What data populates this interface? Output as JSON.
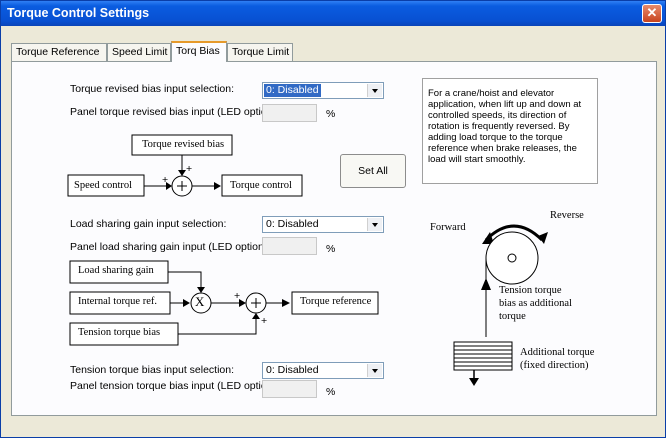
{
  "window": {
    "title": "Torque Control Settings",
    "close_glyph": "✕"
  },
  "tabs": [
    {
      "label": "Torque Reference",
      "active": false
    },
    {
      "label": "Speed Limit",
      "active": false
    },
    {
      "label": "Torq Bias",
      "active": true
    },
    {
      "label": "Torque Limit",
      "active": false
    }
  ],
  "form": {
    "bias_input_label": "Torque revised bias input selection:",
    "bias_input_value": "0: Disabled",
    "bias_panel_label": "Panel torque revised bias input (LED option):",
    "load_sharing_label": "Load sharing gain input selection:",
    "load_sharing_value": "0: Disabled",
    "load_panel_label": "Panel load sharing gain input (LED option):",
    "tension_label": "Tension torque bias input selection:",
    "tension_value": "0: Disabled",
    "tension_panel_label": "Panel tension torque bias input (LED option):",
    "unit": "%"
  },
  "set_all_label": "Set All",
  "info_text": "For a crane/hoist and elevator application, when lift up and down at controlled speeds, its direction of rotation is frequently reversed. By adding load torque to the torque reference when brake releases, the load will start smoothly.",
  "diagram1": {
    "revised_bias": "Torque revised bias",
    "speed_control": "Speed control",
    "torque_control": "Torque control",
    "plus": "+"
  },
  "diagram2": {
    "load_sharing_gain": "Load sharing gain",
    "internal_torque": "Internal torque ref.",
    "tension_bias": "Tension torque bias",
    "torque_reference": "Torque reference",
    "multiply": "X",
    "plus": "+"
  },
  "hoist": {
    "forward": "Forward",
    "reverse": "Reverse",
    "tension_line1": "Tension torque",
    "tension_line2": "bias as additional",
    "tension_line3": "torque",
    "additional_line1": "Additional torque",
    "additional_line2": "(fixed direction)"
  }
}
